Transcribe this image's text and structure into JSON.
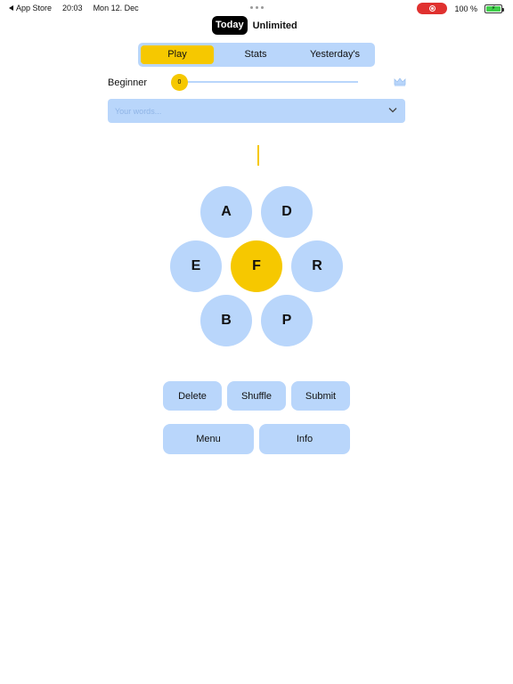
{
  "status_bar": {
    "back_app": "App Store",
    "time": "20:03",
    "date": "Mon 12. Dec",
    "battery_pct": "100 %",
    "battery_level": 1.0
  },
  "mode_toggle": {
    "today": "Today",
    "unlimited": "Unlimited"
  },
  "tabs": [
    {
      "label": "Play",
      "active": true
    },
    {
      "label": "Stats",
      "active": false
    },
    {
      "label": "Yesterday's",
      "active": false
    }
  ],
  "progress": {
    "rank": "Beginner",
    "score": "0",
    "fraction": 0
  },
  "words": {
    "placeholder": "Your words..."
  },
  "letters": {
    "center": "F",
    "outer": [
      "A",
      "D",
      "E",
      "R",
      "B",
      "P"
    ]
  },
  "actions": {
    "delete": "Delete",
    "shuffle": "Shuffle",
    "submit": "Submit",
    "menu": "Menu",
    "info": "Info"
  },
  "colors": {
    "accent_yellow": "#f6c800",
    "light_blue": "#b9d6fb",
    "record_red": "#e0312f",
    "battery_green": "#3fcf4a"
  },
  "icons": {
    "back": "back-triangle-icon",
    "record": "screen-record-icon",
    "battery": "battery-charging-icon",
    "crown": "crown-icon",
    "dropdown": "chevron-down-icon",
    "more": "more-dots-icon"
  }
}
